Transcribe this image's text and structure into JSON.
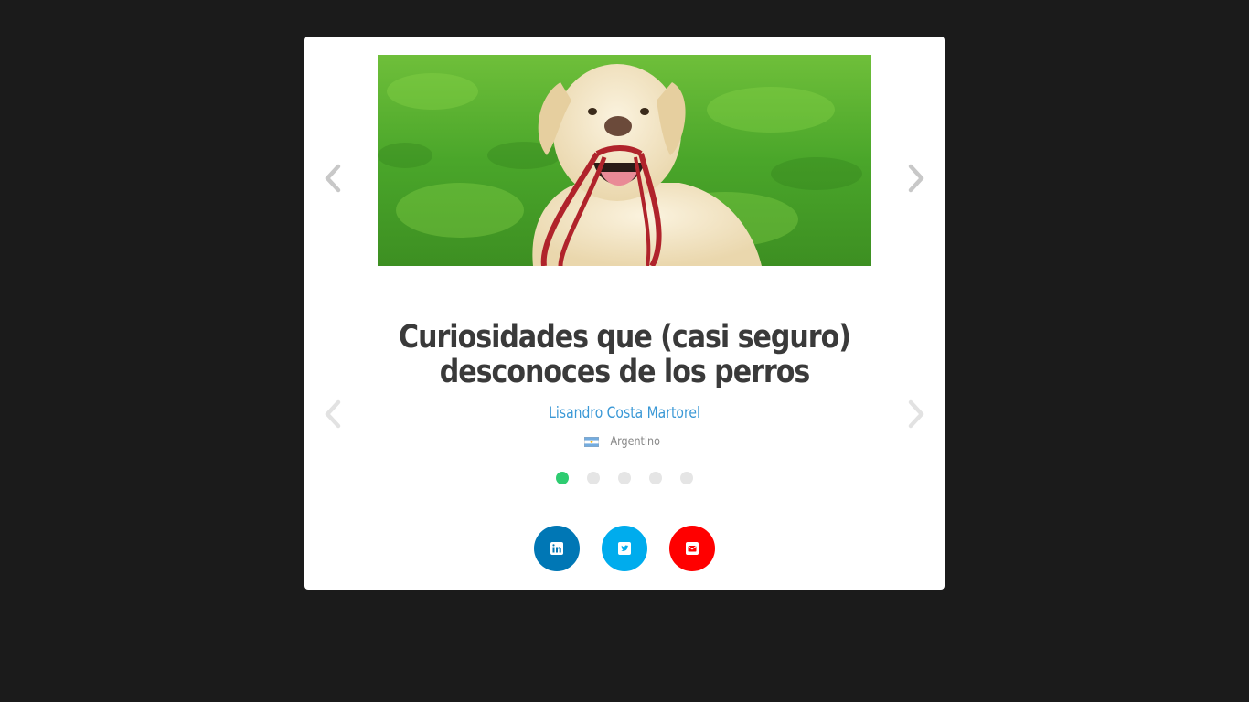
{
  "article": {
    "title_line1": "Curiosidades que (casi seguro)",
    "title_line2": "desconoces de los perros",
    "author": "Lisandro Costa Martorel",
    "nationality": "Argentino",
    "image_subject": "dog-with-leash-photo"
  },
  "carousel": {
    "slide_count": 5,
    "active_index": 0,
    "active_color": "#2ecc71",
    "inactive_color": "#e5e5e5"
  },
  "share": [
    {
      "network": "linkedin",
      "icon": "linkedin-icon",
      "color": "#0077b5"
    },
    {
      "network": "twitter",
      "icon": "twitter-icon",
      "color": "#00aced"
    },
    {
      "network": "email",
      "icon": "mail-icon",
      "color": "#ff0000"
    }
  ],
  "colors": {
    "background": "#1b1b1b",
    "card": "#ffffff",
    "title": "#3a3a3a",
    "author": "#3a98d6",
    "arrow": "#c8c8c8"
  }
}
